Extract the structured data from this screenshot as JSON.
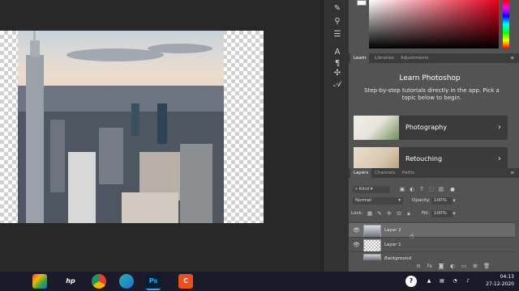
{
  "colors": {
    "accent": "#31a8ff",
    "panel": "#535353",
    "workspace": "#282828"
  },
  "color_panel": {
    "icons": [
      "eyedropper-icon",
      "hue-slider-icon"
    ]
  },
  "tools": [
    "brush-icon",
    "pen-path-icon",
    "adjust-icon",
    "text-icon",
    "paragraph-icon",
    "move-3d-icon",
    "type-a-icon"
  ],
  "top_tabs": {
    "learn": "Learn",
    "libraries": "Libraries",
    "adjustments": "Adjustments"
  },
  "learn": {
    "title": "Learn Photoshop",
    "description": "Step-by-step tutorials directly in the app. Pick a topic below to begin.",
    "cards": [
      {
        "label": "Photography"
      },
      {
        "label": "Retouching"
      }
    ]
  },
  "layer_tabs": {
    "layers": "Layers",
    "channels": "Channels",
    "paths": "Paths"
  },
  "layers_panel": {
    "kind_label": "Kind",
    "blend_mode": "Normal",
    "opacity_label": "Opacity:",
    "opacity_value": "100%",
    "lock_label": "Lock:",
    "fill_label": "Fill:",
    "fill_value": "100%",
    "layers": [
      {
        "name": "Layer 2",
        "selected": true
      },
      {
        "name": "Layer 1",
        "selected": false
      },
      {
        "name": "Background",
        "selected": false
      }
    ]
  },
  "taskbar": {
    "apps": [
      "hp",
      "chrome",
      "edge",
      "photoshop",
      "canva"
    ],
    "ps_label": "Ps",
    "time": "04:13",
    "date": "27-12-2020"
  }
}
